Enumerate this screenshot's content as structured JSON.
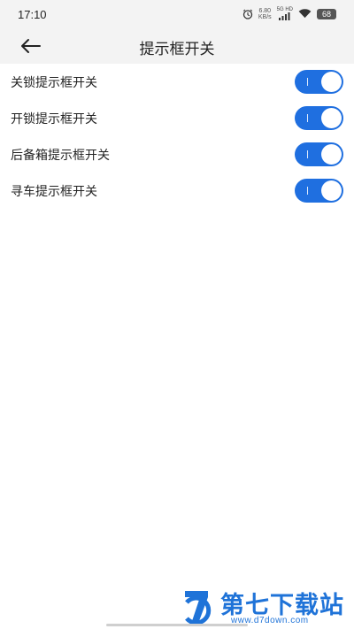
{
  "status_bar": {
    "time": "17:10",
    "net_speed_value": "6.80",
    "net_speed_unit": "KB/s",
    "network_type": "5G HD",
    "battery": "68",
    "icons": [
      "alarm-icon",
      "signal-icon",
      "wifi-icon",
      "battery-icon"
    ]
  },
  "header": {
    "title": "提示框开关",
    "back_icon": "arrow-left-icon"
  },
  "settings": {
    "items": [
      {
        "label": "关锁提示框开关",
        "enabled": true
      },
      {
        "label": "开锁提示框开关",
        "enabled": true
      },
      {
        "label": "后备箱提示框开关",
        "enabled": true
      },
      {
        "label": "寻车提示框开关",
        "enabled": true
      }
    ]
  },
  "watermark": {
    "name": "第七下载站",
    "url": "www.d7down.com"
  },
  "colors": {
    "accent": "#1f6fe0",
    "header_bg": "#f3f3f3",
    "page_bg": "#ffffff",
    "watermark": "#1f73d8"
  }
}
